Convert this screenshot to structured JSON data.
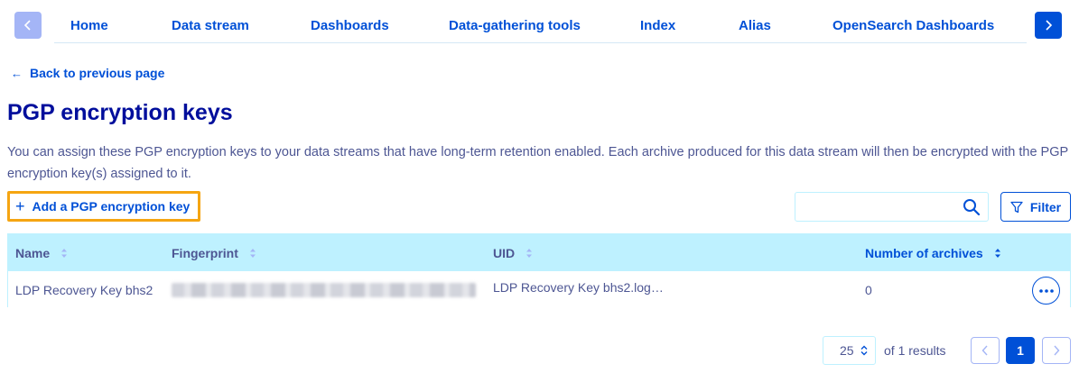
{
  "nav": {
    "tabs": [
      {
        "label": "Home"
      },
      {
        "label": "Data stream"
      },
      {
        "label": "Dashboards"
      },
      {
        "label": "Data-gathering tools"
      },
      {
        "label": "Index"
      },
      {
        "label": "Alias"
      },
      {
        "label": "OpenSearch Dashboards"
      }
    ],
    "prev_icon": "chevron-left-icon",
    "next_icon": "chevron-right-icon"
  },
  "back_link": {
    "label": "Back to previous page",
    "icon": "arrow-left-icon"
  },
  "page": {
    "title": "PGP encryption keys",
    "description": "You can assign these PGP encryption keys to your data streams that have long-term retention enabled. Each archive produced for this data stream will then be encrypted with the PGP encryption key(s) assigned to it."
  },
  "toolbar": {
    "add_label": "Add a PGP encryption key",
    "search_value": "",
    "filter_label": "Filter",
    "highlight_color": "#f5a512"
  },
  "table": {
    "columns": [
      {
        "label": "Name"
      },
      {
        "label": "Fingerprint"
      },
      {
        "label": "UID"
      },
      {
        "label": "Number of archives"
      }
    ],
    "rows": [
      {
        "name": "LDP Recovery Key bhs2",
        "fingerprint": "",
        "uid": "LDP Recovery Key bhs2.log…",
        "archives": "0"
      }
    ]
  },
  "pagination": {
    "page_size": "25",
    "results_text": "of 1 results",
    "current_page": "1"
  },
  "colors": {
    "primary": "#0050d7",
    "title": "#000e9c",
    "text": "#4d5693",
    "table_header_bg": "#bef1ff",
    "disabled_nav": "#a4b5f6"
  }
}
